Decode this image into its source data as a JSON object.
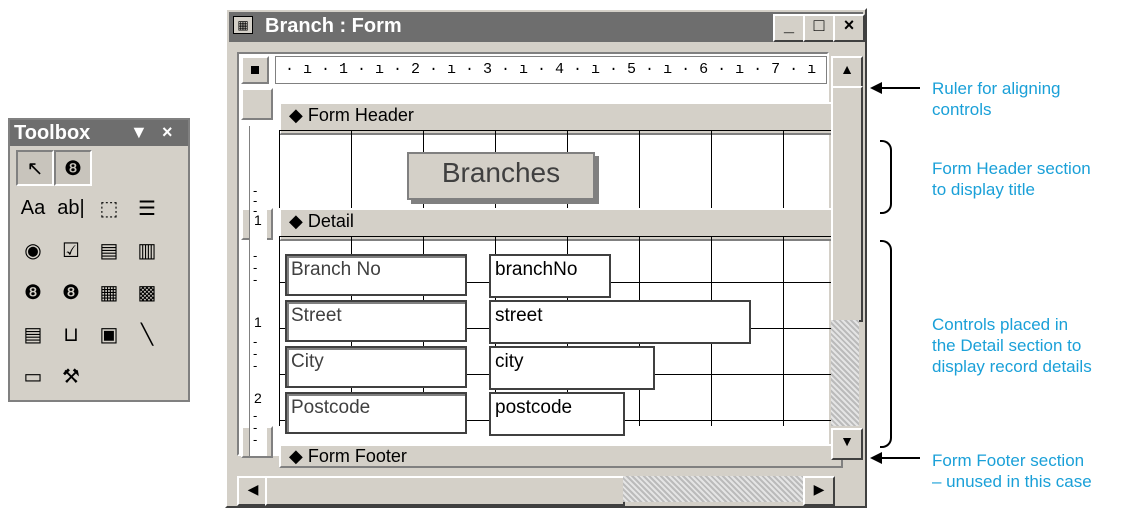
{
  "toolbox": {
    "title": "Toolbox",
    "dropdown_glyph": "▼",
    "close_glyph": "×",
    "tools": [
      {
        "name": "select-pointer-icon",
        "glyph": "↖"
      },
      {
        "name": "control-wizards-icon",
        "glyph": "❽"
      },
      {
        "name": "label-tool-icon",
        "glyph": "Aa"
      },
      {
        "name": "text-box-tool-icon",
        "glyph": "ab|"
      },
      {
        "name": "option-group-tool-icon",
        "glyph": "⬚"
      },
      {
        "name": "toggle-button-tool-icon",
        "glyph": "☰"
      },
      {
        "name": "option-button-tool-icon",
        "glyph": "◉"
      },
      {
        "name": "check-box-tool-icon",
        "glyph": "☑"
      },
      {
        "name": "combo-box-tool-icon",
        "glyph": "▤"
      },
      {
        "name": "list-box-tool-icon",
        "glyph": "▥"
      },
      {
        "name": "command-button-tool-icon",
        "glyph": "❽"
      },
      {
        "name": "image-tool-icon",
        "glyph": "❽"
      },
      {
        "name": "unbound-object-frame-icon",
        "glyph": "▦"
      },
      {
        "name": "bound-object-frame-icon",
        "glyph": "▩"
      },
      {
        "name": "page-break-tool-icon",
        "glyph": "▤"
      },
      {
        "name": "tab-control-tool-icon",
        "glyph": "⊔"
      },
      {
        "name": "subform-tool-icon",
        "glyph": "▣"
      },
      {
        "name": "line-tool-icon",
        "glyph": "╲"
      },
      {
        "name": "rectangle-tool-icon",
        "glyph": "▭"
      },
      {
        "name": "more-controls-icon",
        "glyph": "⚒"
      }
    ]
  },
  "window": {
    "title": "Branch : Form",
    "icon_glyph": "▦",
    "minimize_glyph": "_",
    "maximize_glyph": "□",
    "close_glyph": "×"
  },
  "ruler": {
    "text": " · ı · 1 · ı · 2 · ı · 3 · ı · 4 · ı · 5 · ı · 6 · ı · 7 · ı",
    "vertical_marks": [
      "1",
      "1",
      "2"
    ]
  },
  "sections": {
    "header": "Form Header",
    "detail": "Detail",
    "footer": "Form Footer",
    "section_glyph": "◆"
  },
  "title_label": "Branches",
  "controls": [
    {
      "label": "Branch No",
      "field": "branchNo"
    },
    {
      "label": "Street",
      "field": "street"
    },
    {
      "label": "City",
      "field": "city"
    },
    {
      "label": "Postcode",
      "field": "postcode"
    }
  ],
  "scroll": {
    "up": "▲",
    "down": "▼",
    "left": "◀",
    "right": "▶"
  },
  "annotations": {
    "ruler": [
      "Ruler for aligning",
      "controls"
    ],
    "header": [
      "Form Header section",
      "to display title"
    ],
    "detail": [
      "Controls placed in",
      "the Detail section to",
      "display record details"
    ],
    "footer": [
      "Form Footer section",
      "– unused in this case"
    ]
  },
  "colors": {
    "annotation": "#1aa0d8",
    "titlebar": "#6e6e6e",
    "face": "#d4d0c8"
  }
}
